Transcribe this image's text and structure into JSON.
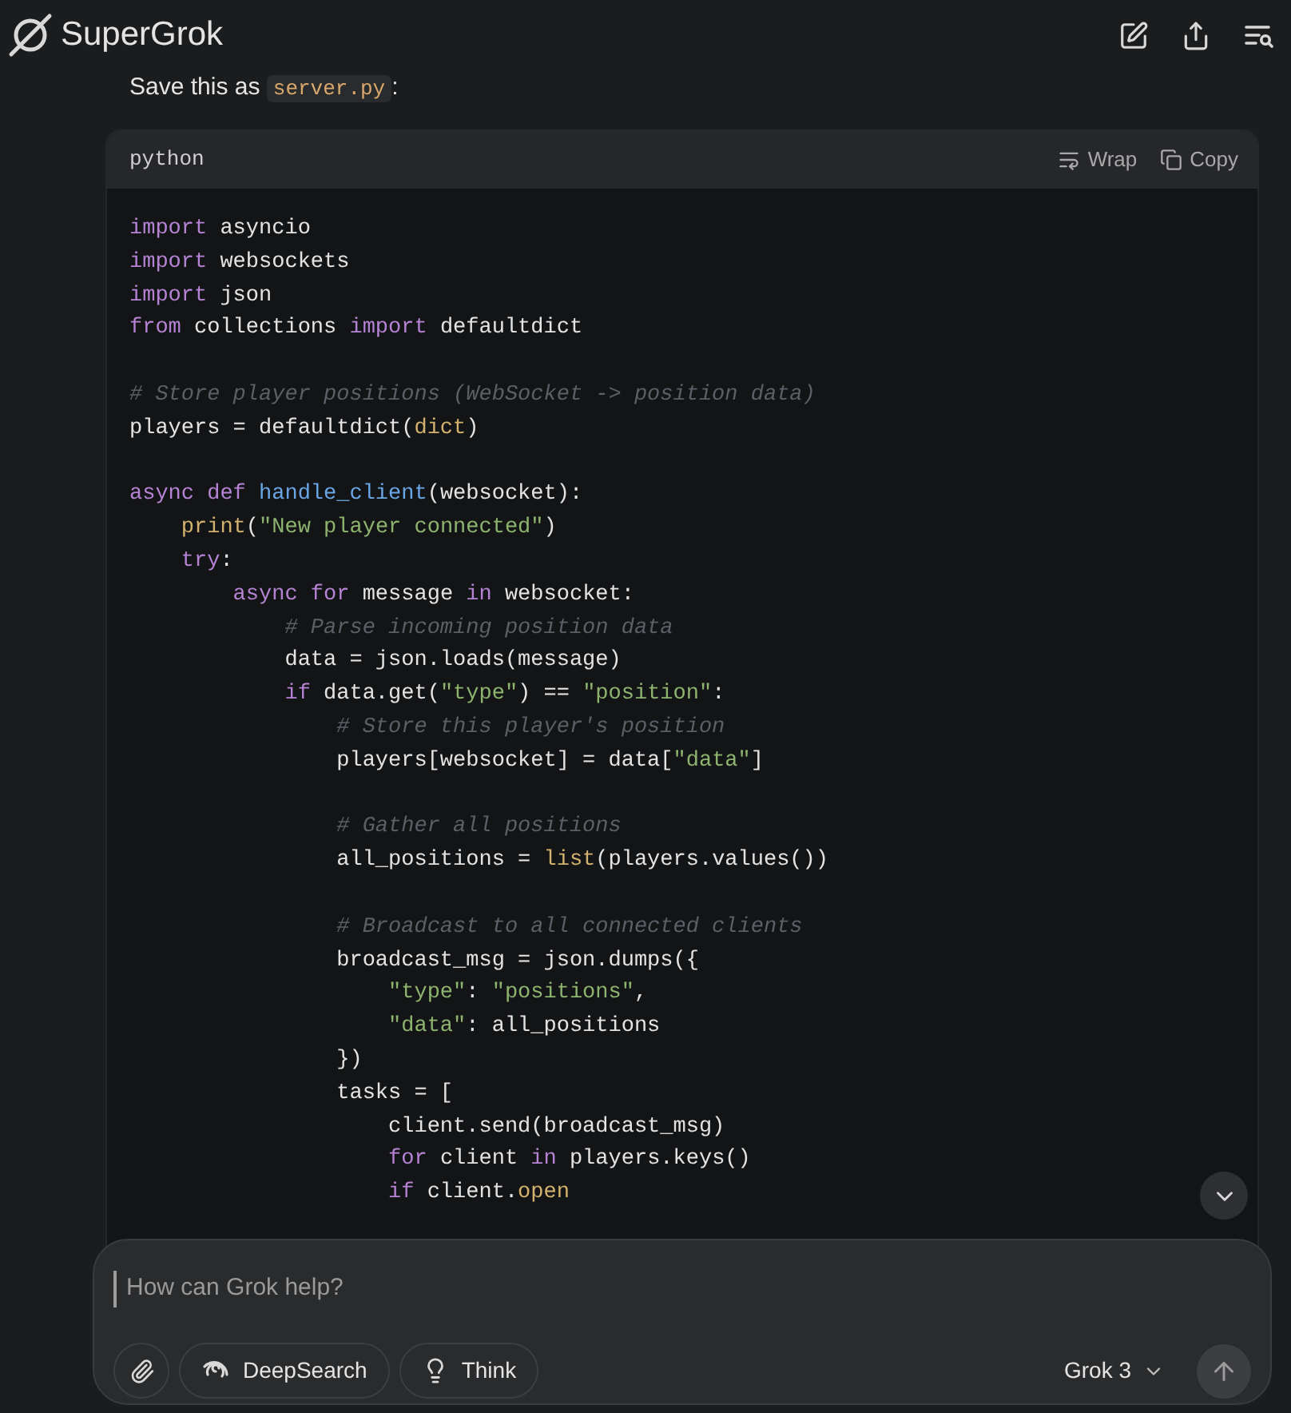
{
  "header": {
    "brand": "SuperGrok"
  },
  "message": {
    "before": "Save this as ",
    "file": "server.py",
    "after": ":"
  },
  "code_block": {
    "language": "python",
    "wrap_label": "Wrap",
    "copy_label": "Copy",
    "lines": [
      {
        "kind": "code",
        "tokens": [
          {
            "kind": "kw",
            "text": "import"
          },
          {
            "kind": "plain",
            "text": " asyncio"
          }
        ]
      },
      {
        "kind": "code",
        "tokens": [
          {
            "kind": "kw",
            "text": "import"
          },
          {
            "kind": "plain",
            "text": " websockets"
          }
        ]
      },
      {
        "kind": "code",
        "tokens": [
          {
            "kind": "kw",
            "text": "import"
          },
          {
            "kind": "plain",
            "text": " json"
          }
        ]
      },
      {
        "kind": "code",
        "tokens": [
          {
            "kind": "kw",
            "text": "from"
          },
          {
            "kind": "plain",
            "text": " collections "
          },
          {
            "kind": "kw",
            "text": "import"
          },
          {
            "kind": "plain",
            "text": " defaultdict"
          }
        ]
      },
      {
        "kind": "blank"
      },
      {
        "kind": "code",
        "tokens": [
          {
            "kind": "comment",
            "text": "# Store player positions (WebSocket -> position data)"
          }
        ]
      },
      {
        "kind": "code",
        "tokens": [
          {
            "kind": "plain",
            "text": "players = defaultdict("
          },
          {
            "kind": "builtin",
            "text": "dict"
          },
          {
            "kind": "plain",
            "text": ")"
          }
        ]
      },
      {
        "kind": "blank"
      },
      {
        "kind": "code",
        "tokens": [
          {
            "kind": "kw",
            "text": "async def "
          },
          {
            "kind": "fn",
            "text": "handle_client"
          },
          {
            "kind": "plain",
            "text": "(websocket):"
          }
        ]
      },
      {
        "kind": "code",
        "tokens": [
          {
            "kind": "builtin",
            "text": "    print"
          },
          {
            "kind": "plain",
            "text": "("
          },
          {
            "kind": "str",
            "text": "\"New player connected\""
          },
          {
            "kind": "plain",
            "text": ")"
          }
        ]
      },
      {
        "kind": "code",
        "tokens": [
          {
            "kind": "kw",
            "text": "    try"
          },
          {
            "kind": "plain",
            "text": ":"
          }
        ]
      },
      {
        "kind": "code",
        "tokens": [
          {
            "kind": "kw",
            "text": "        async for"
          },
          {
            "kind": "plain",
            "text": " message "
          },
          {
            "kind": "kw",
            "text": "in"
          },
          {
            "kind": "plain",
            "text": " websocket:"
          }
        ]
      },
      {
        "kind": "code",
        "tokens": [
          {
            "kind": "comment",
            "text": "            # Parse incoming position data"
          }
        ]
      },
      {
        "kind": "code",
        "tokens": [
          {
            "kind": "plain",
            "text": "            data = json.loads(message)"
          }
        ]
      },
      {
        "kind": "code",
        "tokens": [
          {
            "kind": "kw",
            "text": "            if"
          },
          {
            "kind": "plain",
            "text": " data.get("
          },
          {
            "kind": "str",
            "text": "\"type\""
          },
          {
            "kind": "plain",
            "text": ") == "
          },
          {
            "kind": "str",
            "text": "\"position\""
          },
          {
            "kind": "plain",
            "text": ":"
          }
        ]
      },
      {
        "kind": "code",
        "tokens": [
          {
            "kind": "comment",
            "text": "                # Store this player's position"
          }
        ]
      },
      {
        "kind": "code",
        "tokens": [
          {
            "kind": "plain",
            "text": "                players[websocket] = data["
          },
          {
            "kind": "str",
            "text": "\"data\""
          },
          {
            "kind": "plain",
            "text": "]"
          }
        ]
      },
      {
        "kind": "blank"
      },
      {
        "kind": "code",
        "tokens": [
          {
            "kind": "comment",
            "text": "                # Gather all positions"
          }
        ]
      },
      {
        "kind": "code",
        "tokens": [
          {
            "kind": "plain",
            "text": "                all_positions = "
          },
          {
            "kind": "builtin",
            "text": "list"
          },
          {
            "kind": "plain",
            "text": "(players.values())"
          }
        ]
      },
      {
        "kind": "blank"
      },
      {
        "kind": "code",
        "tokens": [
          {
            "kind": "comment",
            "text": "                # Broadcast to all connected clients"
          }
        ]
      },
      {
        "kind": "code",
        "tokens": [
          {
            "kind": "plain",
            "text": "                broadcast_msg = json.dumps({"
          }
        ]
      },
      {
        "kind": "code",
        "tokens": [
          {
            "kind": "str",
            "text": "                    \"type\""
          },
          {
            "kind": "plain",
            "text": ": "
          },
          {
            "kind": "str",
            "text": "\"positions\""
          },
          {
            "kind": "plain",
            "text": ","
          }
        ]
      },
      {
        "kind": "code",
        "tokens": [
          {
            "kind": "str",
            "text": "                    \"data\""
          },
          {
            "kind": "plain",
            "text": ": all_positions"
          }
        ]
      },
      {
        "kind": "code",
        "tokens": [
          {
            "kind": "plain",
            "text": "                })"
          }
        ]
      },
      {
        "kind": "code",
        "tokens": [
          {
            "kind": "plain",
            "text": "                tasks = ["
          }
        ]
      },
      {
        "kind": "code",
        "tokens": [
          {
            "kind": "plain",
            "text": "                    client.send(broadcast_msg)"
          }
        ]
      },
      {
        "kind": "code",
        "tokens": [
          {
            "kind": "kw",
            "text": "                    for"
          },
          {
            "kind": "plain",
            "text": " client "
          },
          {
            "kind": "kw",
            "text": "in"
          },
          {
            "kind": "plain",
            "text": " players.keys()"
          }
        ]
      },
      {
        "kind": "code",
        "tokens": [
          {
            "kind": "kw",
            "text": "                    if"
          },
          {
            "kind": "plain",
            "text": " client."
          },
          {
            "kind": "builtin",
            "text": "open"
          }
        ]
      }
    ]
  },
  "composer": {
    "placeholder": "How can Grok help?",
    "tools": [
      {
        "kind": "deepsearch",
        "label": "DeepSearch"
      },
      {
        "kind": "think",
        "label": "Think"
      }
    ],
    "model": "Grok 3"
  }
}
